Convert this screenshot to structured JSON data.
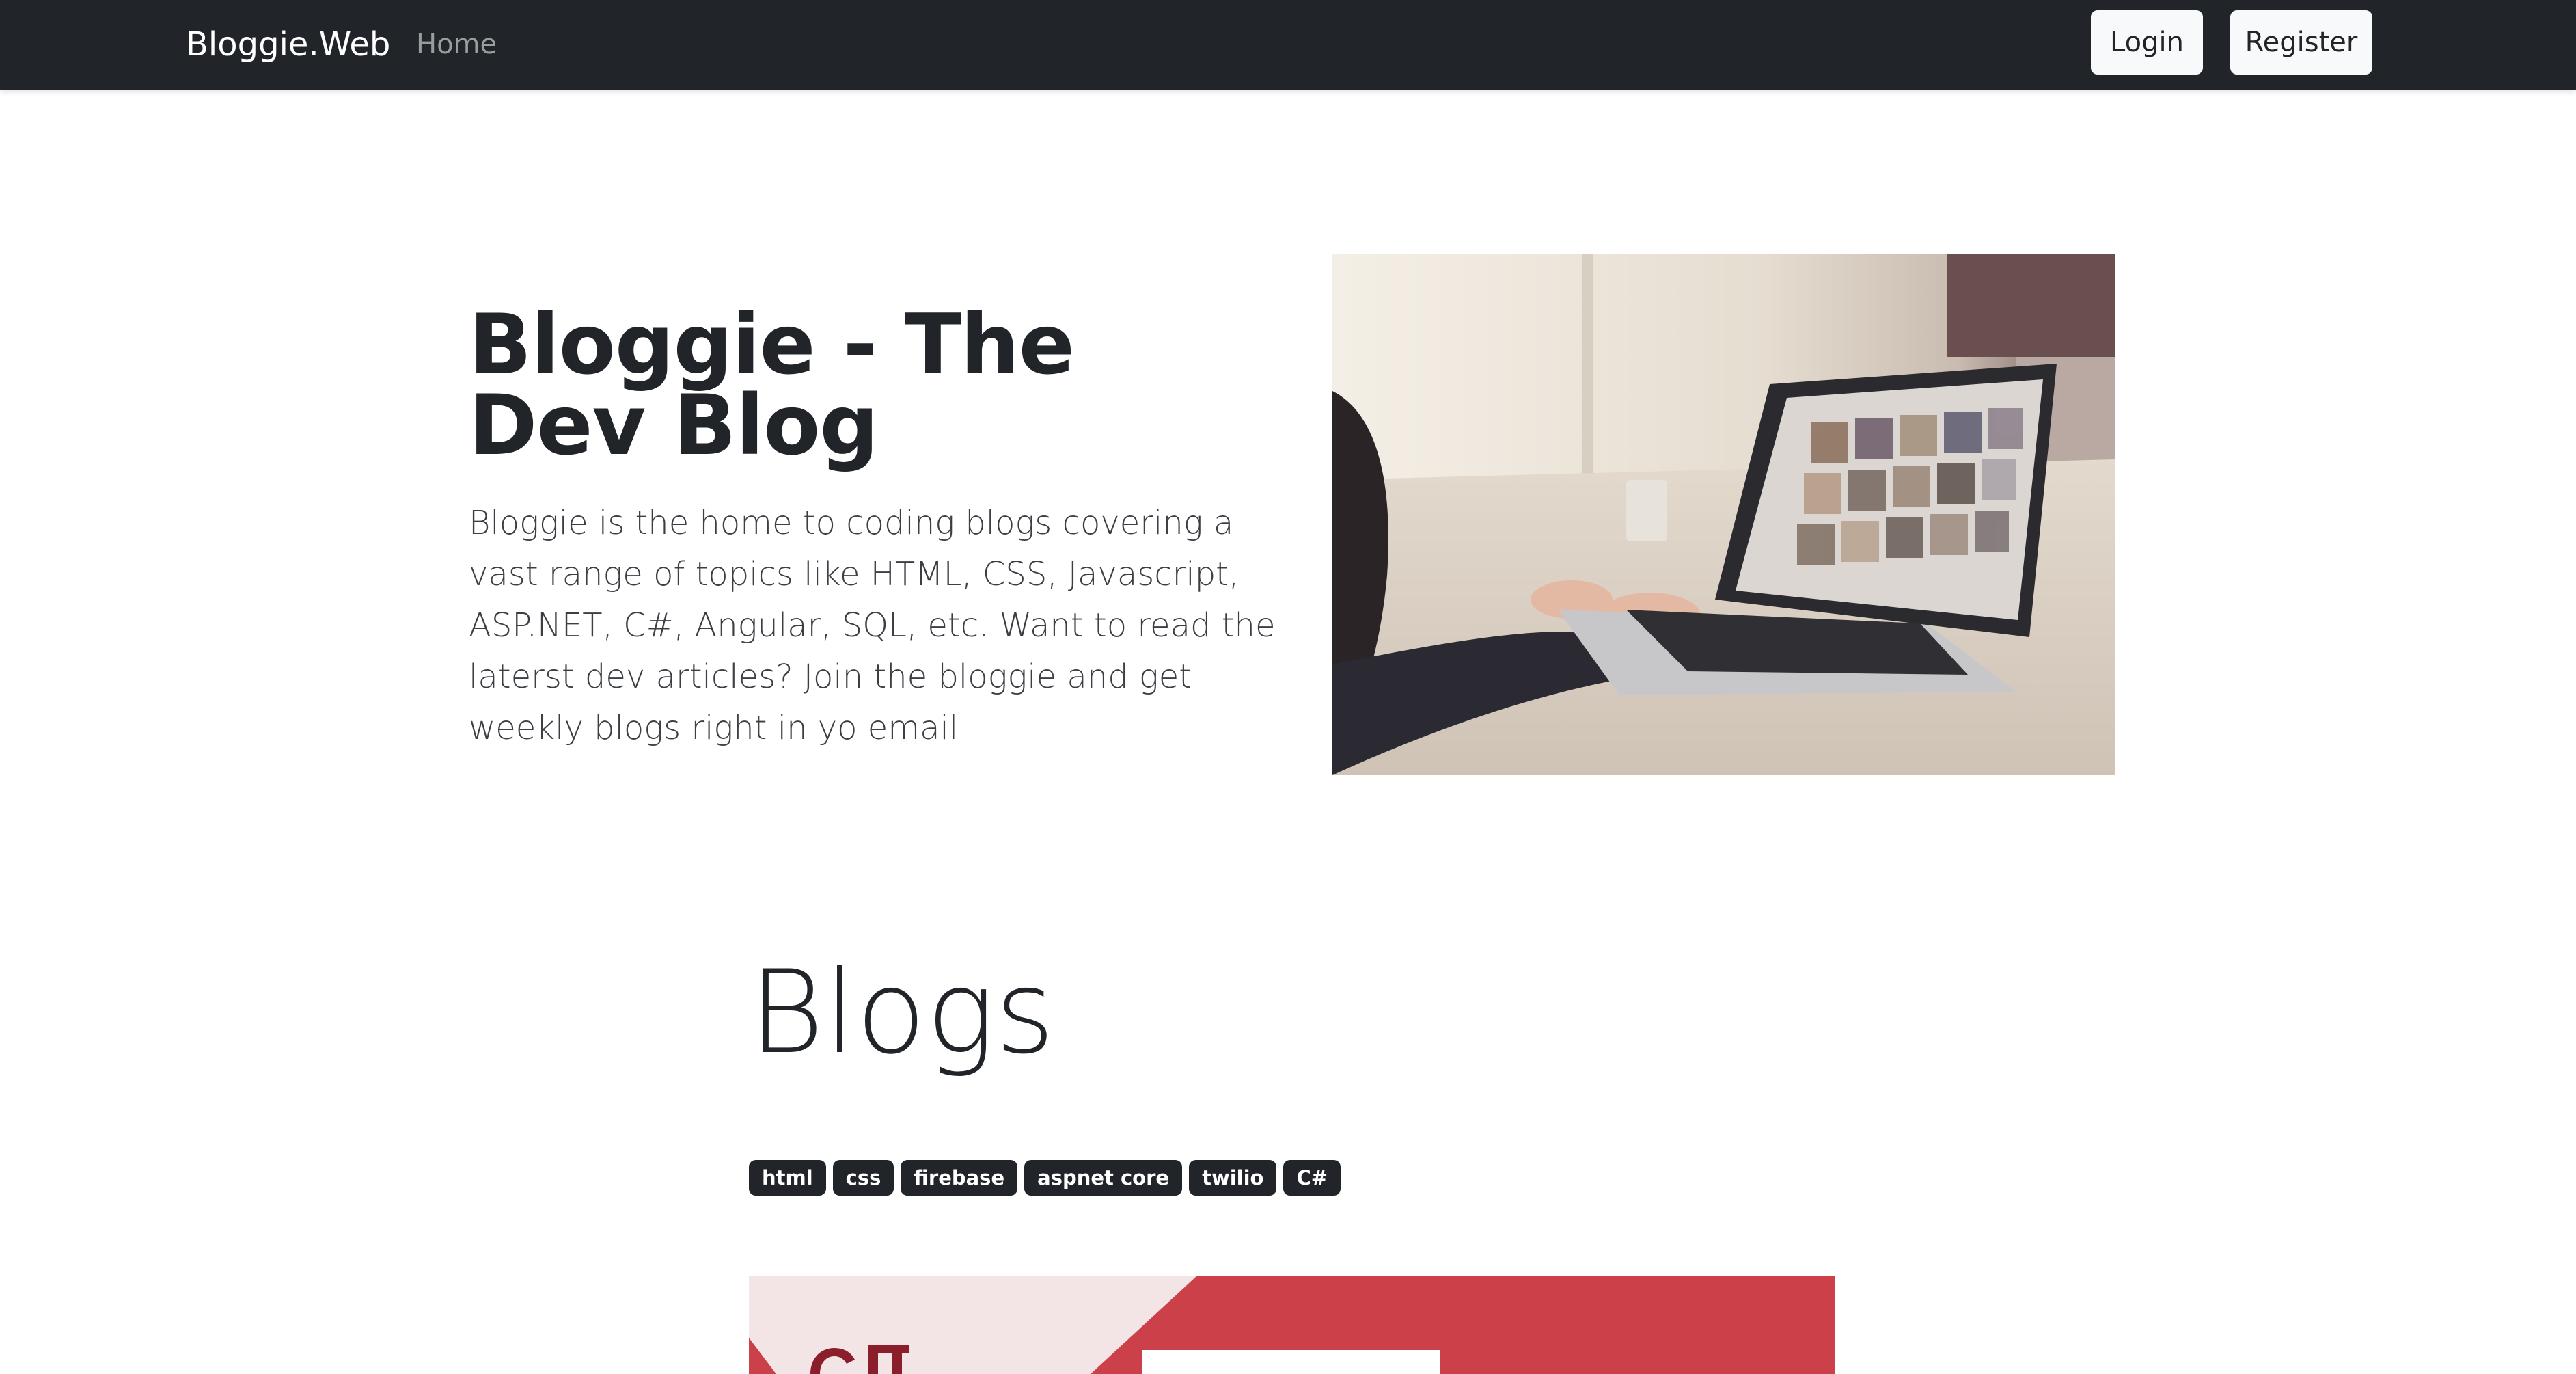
{
  "navbar": {
    "brand": "Bloggie.Web",
    "links": [
      {
        "label": "Home"
      }
    ],
    "login_label": "Login",
    "register_label": "Register",
    "background": "#212529"
  },
  "hero": {
    "title": "Bloggie - The Dev Blog",
    "description": "Bloggie is the home to coding blogs covering a vast range of topics like HTML, CSS, Javascript, ASP.NET, C#, Angular, SQL, etc. Want to read the laterst dev articles? Join the bloggie and get weekly blogs right in yo email",
    "image": "laptop-photo"
  },
  "blogs": {
    "heading": "Blogs",
    "tags": [
      {
        "label": "html"
      },
      {
        "label": "css"
      },
      {
        "label": "firebase"
      },
      {
        "label": "aspnet core"
      },
      {
        "label": "twilio"
      },
      {
        "label": "C#"
      }
    ],
    "first_post_image": "aspnet-csharp-banner",
    "accent_color": "#cc4049"
  }
}
